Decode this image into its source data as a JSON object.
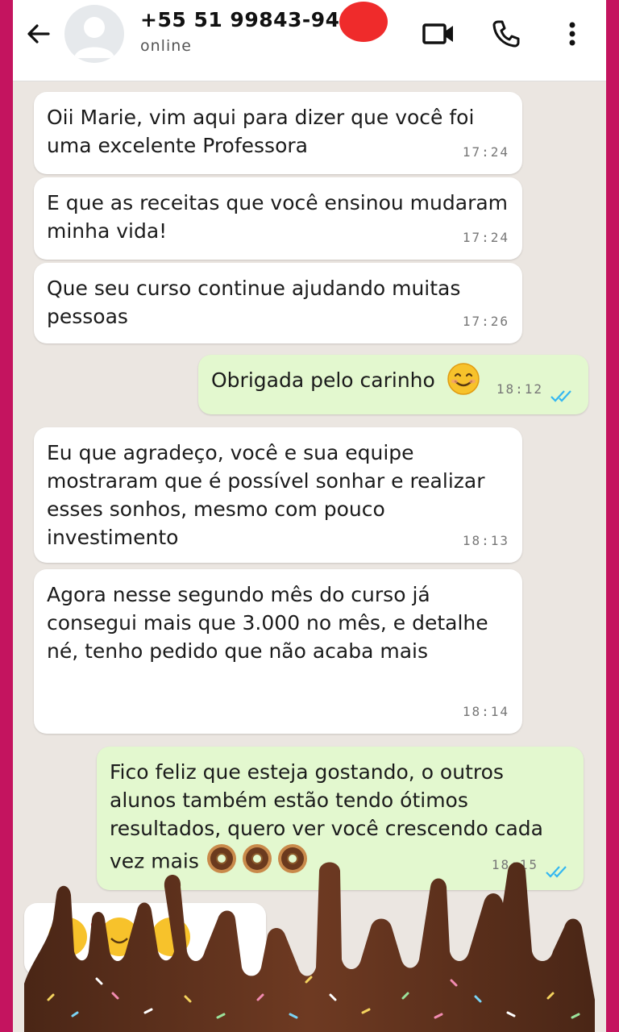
{
  "header": {
    "contact_name": "+55 51 99843-94",
    "status": "online"
  },
  "messages": [
    {
      "text": "Oii Marie, vim aqui para dizer que você foi uma excelente Professora",
      "time": "17:24"
    },
    {
      "text": "E que as receitas que você ensinou mudaram minha vida!",
      "time": "17:24"
    },
    {
      "text": "Que seu curso continue ajudando muitas pessoas",
      "time": "17:26"
    },
    {
      "text": "Obrigada pelo carinho",
      "time": "18:12"
    },
    {
      "text": "Eu que agradeço, você e sua equipe mostraram que é possível sonhar e realizar esses sonhos, mesmo com pouco investimento",
      "time": "18:13"
    },
    {
      "text": "Agora nesse segundo mês  do curso já consegui mais que 3.000 no mês, e detalhe né, tenho pedido que não acaba mais",
      "time": "18:14"
    },
    {
      "text": "Fico feliz que esteja gostando, o outros alunos também estão tendo ótimos resultados, quero ver você crescendo cada vez mais",
      "time": "18:15"
    }
  ],
  "icons": {
    "back": "arrow-left-icon",
    "video": "video-camera-icon",
    "call": "phone-icon",
    "menu": "more-vertical-icon",
    "read": "double-check-icon"
  },
  "colors": {
    "frame": "#c4145f",
    "chat_bg": "#ebe6e1",
    "incoming": "#ffffff",
    "outgoing": "#e3f8cf",
    "read_ticks": "#34b7f1"
  }
}
